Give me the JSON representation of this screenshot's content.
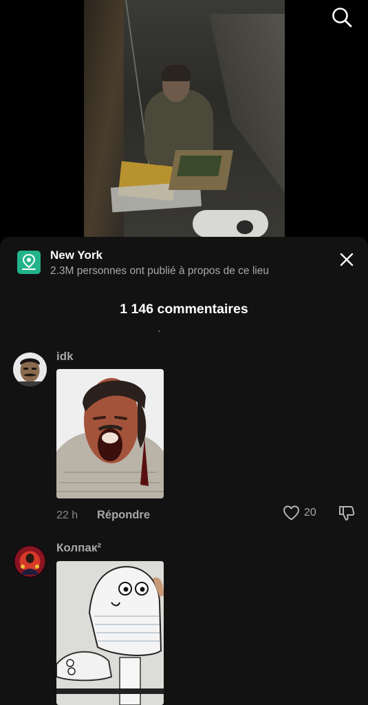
{
  "location": {
    "name": "New York",
    "subtitle": "2.3M personnes ont publié à propos de ce lieu"
  },
  "comments_header": "1 146 commentaires",
  "comments": [
    {
      "username": "idk",
      "time": "22 h",
      "reply_label": "Répondre",
      "likes": "20"
    },
    {
      "username": "Колпак²"
    }
  ],
  "colors": {
    "accent": "#23b38a",
    "sheet_bg": "#121212",
    "muted_text": "#a8a8a8"
  },
  "icons": {
    "search": "search-icon",
    "close": "close-icon",
    "location": "location-pin-icon",
    "like": "heart-icon",
    "dislike": "thumbs-down-icon"
  }
}
